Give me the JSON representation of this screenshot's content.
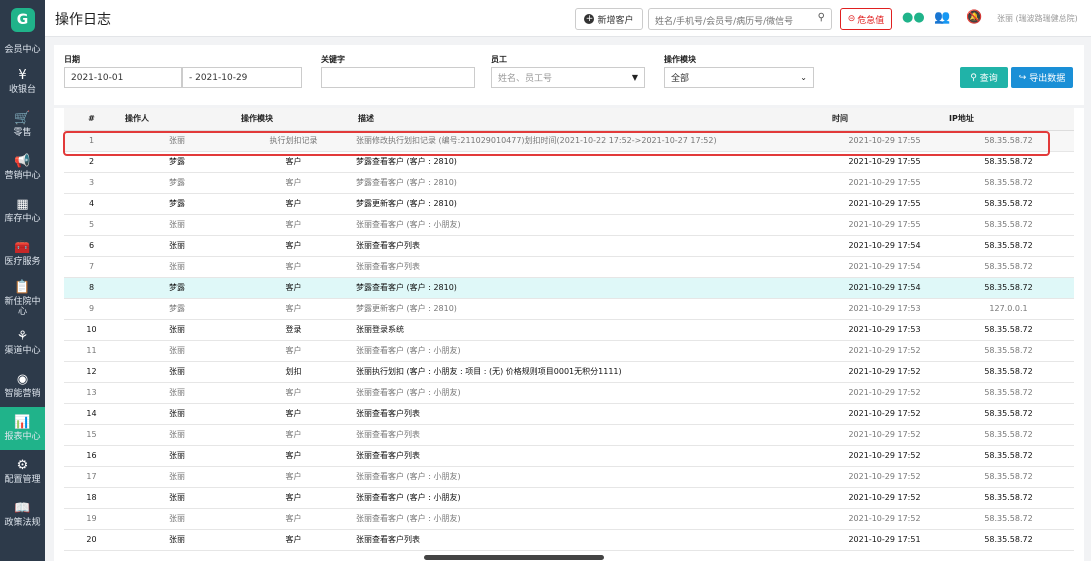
{
  "sidebar": {
    "logo": "G",
    "items": [
      {
        "label": "会员中心",
        "icon": ""
      },
      {
        "label": "收银台",
        "icon": "¥"
      },
      {
        "label": "零售",
        "icon": "🛒"
      },
      {
        "label": "营销中心",
        "icon": "📢"
      },
      {
        "label": "库存中心",
        "icon": "▦"
      },
      {
        "label": "医疗服务",
        "icon": "🧰"
      },
      {
        "label": "新住院中心",
        "icon": "📋"
      },
      {
        "label": "渠道中心",
        "icon": "⚘"
      },
      {
        "label": "智能营销",
        "icon": "◉"
      },
      {
        "label": "报表中心",
        "icon": "📊"
      },
      {
        "label": "配置管理",
        "icon": "⚙"
      },
      {
        "label": "政策法规",
        "icon": "📖"
      }
    ]
  },
  "header": {
    "title": "操作日志",
    "new_customer": "新增客户",
    "search_placeholder": "姓名/手机号/会员号/病历号/微信号",
    "critical": "危急值",
    "user": "张丽 (瑞波路瑞健总院)"
  },
  "filters": {
    "date_label": "日期",
    "date_start": "2021-10-01",
    "date_end": "2021-10-29",
    "keyword_label": "关键字",
    "keyword_value": "",
    "employee_label": "员工",
    "employee_placeholder": "姓名、员工号",
    "module_label": "操作模块",
    "module_value": "全部",
    "query_button": "查询",
    "export_button": "导出数据"
  },
  "table": {
    "headers": [
      "#",
      "操作人",
      "操作模块",
      "描述",
      "时间",
      "IP地址"
    ],
    "rows": [
      {
        "n": "1",
        "op": "张丽",
        "mod": "执行划扣记录",
        "desc": "张丽修改执行划扣记录 (编号:211029010477)划扣时间(2021-10-22 17:52->2021-10-27 17:52)",
        "time": "2021-10-29 17:55",
        "ip": "58.35.58.72"
      },
      {
        "n": "2",
        "op": "梦露",
        "mod": "客户",
        "desc": "梦露查看客户 (客户 : 2810)",
        "time": "2021-10-29 17:55",
        "ip": "58.35.58.72"
      },
      {
        "n": "3",
        "op": "梦露",
        "mod": "客户",
        "desc": "梦露查看客户 (客户 : 2810)",
        "time": "2021-10-29 17:55",
        "ip": "58.35.58.72"
      },
      {
        "n": "4",
        "op": "梦露",
        "mod": "客户",
        "desc": "梦露更新客户 (客户 : 2810)",
        "time": "2021-10-29 17:55",
        "ip": "58.35.58.72"
      },
      {
        "n": "5",
        "op": "张丽",
        "mod": "客户",
        "desc": "张丽查看客户 (客户 : 小朋友)",
        "time": "2021-10-29 17:55",
        "ip": "58.35.58.72"
      },
      {
        "n": "6",
        "op": "张丽",
        "mod": "客户",
        "desc": "张丽查看客户列表",
        "time": "2021-10-29 17:54",
        "ip": "58.35.58.72"
      },
      {
        "n": "7",
        "op": "张丽",
        "mod": "客户",
        "desc": "张丽查看客户列表",
        "time": "2021-10-29 17:54",
        "ip": "58.35.58.72"
      },
      {
        "n": "8",
        "op": "梦露",
        "mod": "客户",
        "desc": "梦露查看客户 (客户 : 2810)",
        "time": "2021-10-29 17:54",
        "ip": "58.35.58.72"
      },
      {
        "n": "9",
        "op": "梦露",
        "mod": "客户",
        "desc": "梦露更新客户 (客户 : 2810)",
        "time": "2021-10-29 17:53",
        "ip": "127.0.0.1"
      },
      {
        "n": "10",
        "op": "张丽",
        "mod": "登录",
        "desc": "张丽登录系统",
        "time": "2021-10-29 17:53",
        "ip": "58.35.58.72"
      },
      {
        "n": "11",
        "op": "张丽",
        "mod": "客户",
        "desc": "张丽查看客户 (客户 : 小朋友)",
        "time": "2021-10-29 17:52",
        "ip": "58.35.58.72"
      },
      {
        "n": "12",
        "op": "张丽",
        "mod": "划扣",
        "desc": "张丽执行划扣 (客户 : 小朋友 : 项目 : (无) 价格规则项目0001无积分1111)",
        "time": "2021-10-29 17:52",
        "ip": "58.35.58.72"
      },
      {
        "n": "13",
        "op": "张丽",
        "mod": "客户",
        "desc": "张丽查看客户 (客户 : 小朋友)",
        "time": "2021-10-29 17:52",
        "ip": "58.35.58.72"
      },
      {
        "n": "14",
        "op": "张丽",
        "mod": "客户",
        "desc": "张丽查看客户列表",
        "time": "2021-10-29 17:52",
        "ip": "58.35.58.72"
      },
      {
        "n": "15",
        "op": "张丽",
        "mod": "客户",
        "desc": "张丽查看客户列表",
        "time": "2021-10-29 17:52",
        "ip": "58.35.58.72"
      },
      {
        "n": "16",
        "op": "张丽",
        "mod": "客户",
        "desc": "张丽查看客户列表",
        "time": "2021-10-29 17:52",
        "ip": "58.35.58.72"
      },
      {
        "n": "17",
        "op": "张丽",
        "mod": "客户",
        "desc": "张丽查看客户 (客户 : 小朋友)",
        "time": "2021-10-29 17:52",
        "ip": "58.35.58.72"
      },
      {
        "n": "18",
        "op": "张丽",
        "mod": "客户",
        "desc": "张丽查看客户 (客户 : 小朋友)",
        "time": "2021-10-29 17:52",
        "ip": "58.35.58.72"
      },
      {
        "n": "19",
        "op": "张丽",
        "mod": "客户",
        "desc": "张丽查看客户 (客户 : 小朋友)",
        "time": "2021-10-29 17:52",
        "ip": "58.35.58.72"
      },
      {
        "n": "20",
        "op": "张丽",
        "mod": "客户",
        "desc": "张丽查看客户列表",
        "time": "2021-10-29 17:51",
        "ip": "58.35.58.72"
      }
    ]
  },
  "colors": {
    "sidebar": "#2d3a4a",
    "accent": "#20b38a",
    "critical": "#e02020",
    "highlight_row": "#dff8f8"
  }
}
